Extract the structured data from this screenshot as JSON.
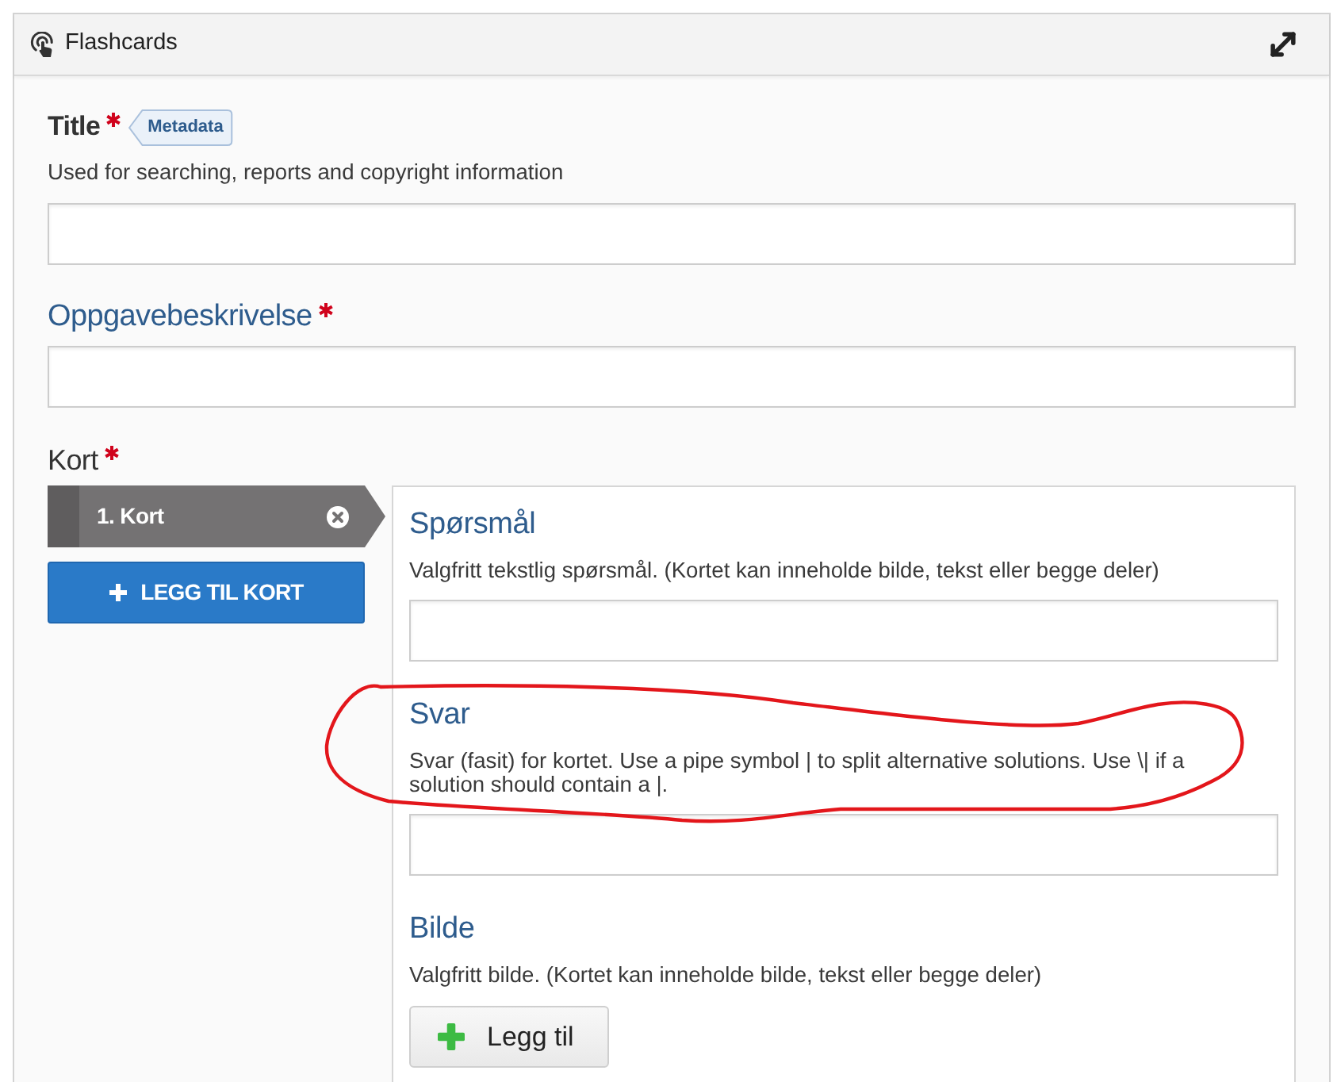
{
  "panel": {
    "title": "Flashcards"
  },
  "title_field": {
    "label": "Title",
    "required": true,
    "tag": "Metadata",
    "description": "Used for searching, reports and copyright information"
  },
  "task_field": {
    "label": "Oppgavebeskrivelse",
    "required": true
  },
  "cards": {
    "label": "Kort",
    "required": true,
    "items": [
      {
        "label": "1. Kort",
        "selected": true
      }
    ],
    "add_button": "LEGG TIL KORT"
  },
  "card_editor": {
    "sections": [
      {
        "kind": "text",
        "heading": "Spørsmål",
        "description": "Valgfritt tekstlig spørsmål. (Kortet kan inneholde bilde, tekst eller begge deler)"
      },
      {
        "kind": "text",
        "heading": "Svar",
        "description": "Svar (fasit) for kortet. Use a pipe symbol | to split alternative solutions. Use \\| if a solution should contain a |."
      },
      {
        "kind": "image",
        "heading": "Bilde",
        "description": "Valgfritt bilde. (Kortet kan inneholde bilde, tekst eller begge deler)",
        "button": "Legg til"
      }
    ]
  }
}
